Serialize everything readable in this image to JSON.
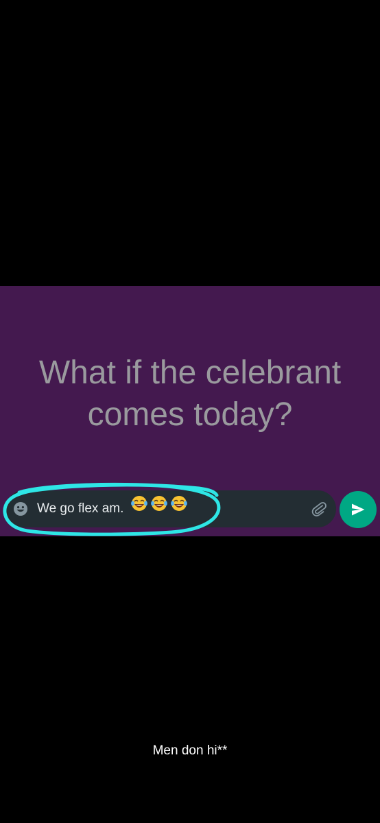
{
  "status": {
    "text": "What if the celebrant comes today?",
    "background_color": "#44194f",
    "text_color": "#9a9a9e"
  },
  "reply": {
    "value": "We go flex am.",
    "emojis": "😂😂😂",
    "emoji_icon": "emoji-smiley-icon",
    "attach_icon": "paperclip-icon",
    "send_icon": "send-arrow-icon",
    "bar_color": "#232d33",
    "send_color": "#00a884"
  },
  "annotation": {
    "marker_color": "#2ee6e6"
  },
  "caption": {
    "text": "Men don hi**"
  }
}
